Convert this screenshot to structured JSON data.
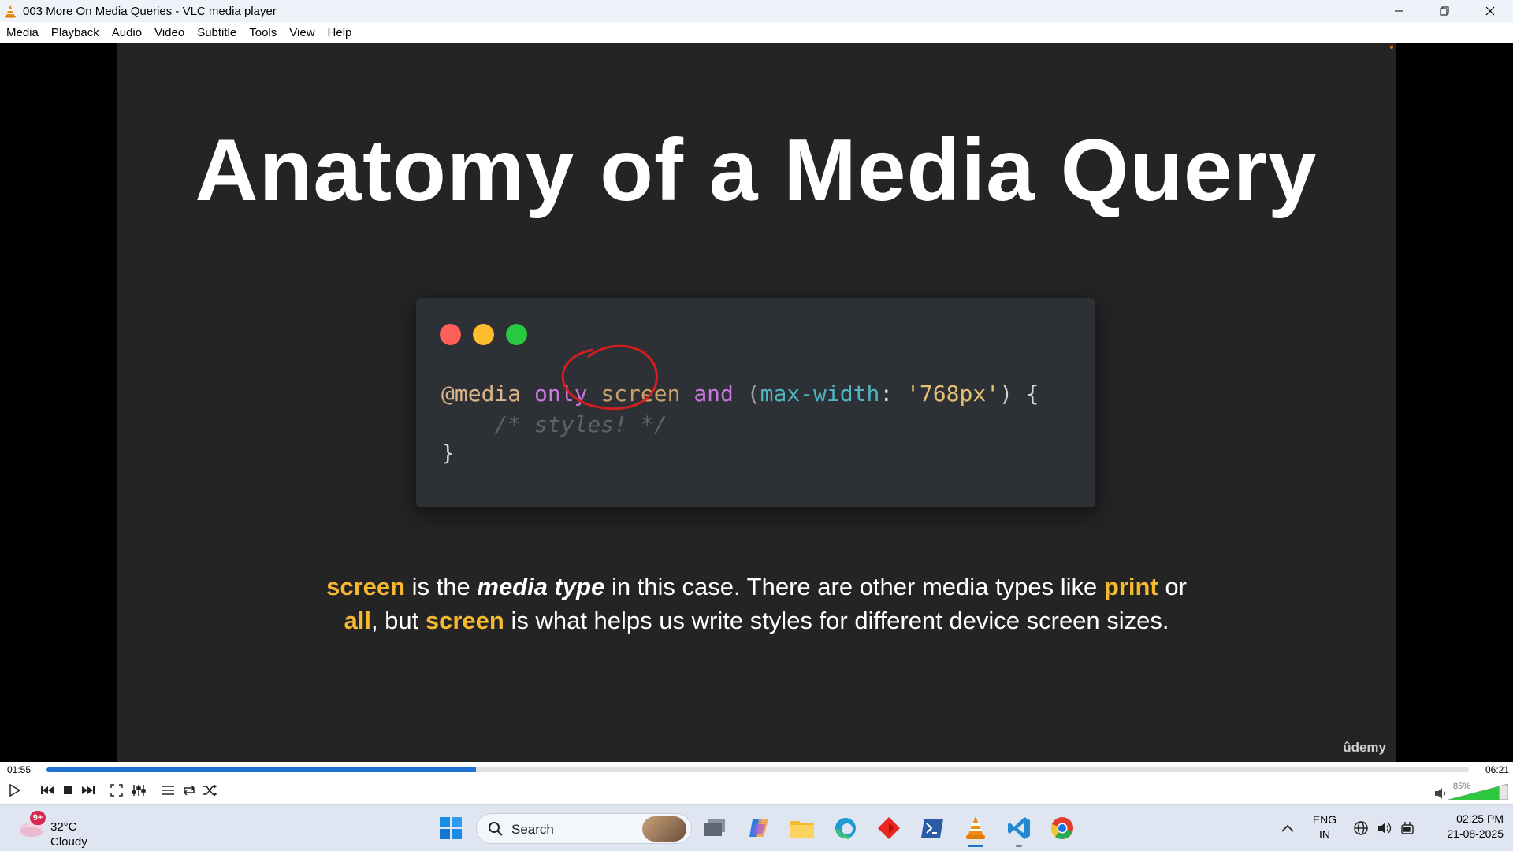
{
  "window": {
    "title": "003 More On Media Queries - VLC media player",
    "icon": "vlc-cone-icon"
  },
  "menu": [
    "Media",
    "Playback",
    "Audio",
    "Video",
    "Subtitle",
    "Tools",
    "View",
    "Help"
  ],
  "slide": {
    "title": "Anatomy of a Media Query",
    "code": {
      "line1": [
        {
          "t": "@media",
          "c": "c-at"
        },
        {
          "t": " ",
          "c": "c-punct"
        },
        {
          "t": "only",
          "c": "c-kw"
        },
        {
          "t": " ",
          "c": "c-punct"
        },
        {
          "t": "screen",
          "c": "c-type"
        },
        {
          "t": " ",
          "c": "c-punct"
        },
        {
          "t": "and",
          "c": "c-kw"
        },
        {
          "t": " (",
          "c": "c-paren"
        },
        {
          "t": "max-width",
          "c": "c-prop"
        },
        {
          "t": ": ",
          "c": "c-punct"
        },
        {
          "t": "'768px'",
          "c": "c-str"
        },
        {
          "t": ") {",
          "c": "c-punct"
        }
      ],
      "line2": "    /* styles! */",
      "line3": "}"
    },
    "caption": [
      {
        "t": "screen",
        "s": "hl"
      },
      {
        "t": " is the ",
        "s": ""
      },
      {
        "t": "media type",
        "s": "em"
      },
      {
        "t": " in this case. There are other media types like ",
        "s": ""
      },
      {
        "t": "print",
        "s": "hl"
      },
      {
        "t": " or ",
        "s": ""
      },
      {
        "t": "all",
        "s": "hl"
      },
      {
        "t": ", but ",
        "s": ""
      },
      {
        "t": "screen",
        "s": "hl"
      },
      {
        "t": " is what helps us write styles for different device screen sizes.",
        "s": ""
      }
    ],
    "watermark": "ûdemy"
  },
  "player": {
    "current_time": "01:55",
    "total_time": "06:21",
    "progress_fraction": 0.302,
    "volume_label": "85%",
    "volume_fraction": 0.85
  },
  "taskbar": {
    "weather_temp": "32°C",
    "weather_cond": "Cloudy",
    "weather_badge": "9+",
    "search_label": "Search",
    "lang_top": "ENG",
    "lang_bottom": "IN",
    "time": "02:25 PM",
    "date": "21-08-2025"
  },
  "colors": {
    "accent": "#1e73d1",
    "slide_bg": "#242424",
    "highlight": "#f5b82e"
  }
}
